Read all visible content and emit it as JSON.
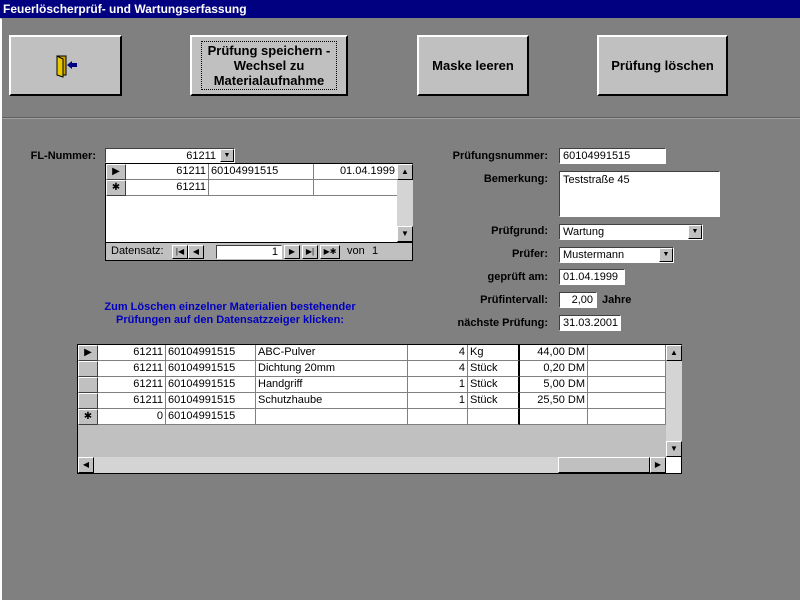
{
  "window": {
    "title": "Feuerlöscherprüf- und Wartungserfassung"
  },
  "toolbar": {
    "save_label": "Prüfung speichern - Wechsel zu Materialaufnahme",
    "clear_label": "Maske leeren",
    "delete_label": "Prüfung löschen"
  },
  "form": {
    "fl_nummer_label": "FL-Nummer:",
    "fl_nummer_value": "61211",
    "pruefungsnummer_label": "Prüfungsnummer:",
    "pruefungsnummer_value": "60104991515",
    "bemerkung_label": "Bemerkung:",
    "bemerkung_value": "Teststraße 45",
    "pruefgrund_label": "Prüfgrund:",
    "pruefgrund_value": "Wartung",
    "pruefer_label": "Prüfer:",
    "pruefer_value": "Mustermann",
    "geprueft_am_label": "geprüft am:",
    "geprueft_am_value": "01.04.1999",
    "pruefintervall_label": "Prüfintervall:",
    "pruefintervall_value": "2,00",
    "pruefintervall_unit": "Jahre",
    "naechste_pruefung_label": "nächste Prüfung:",
    "naechste_pruefung_value": "31.03.2001"
  },
  "subform": {
    "rows": [
      {
        "fl": "61211",
        "nummer": "60104991515",
        "datum": "01.04.1999"
      },
      {
        "fl": "61211",
        "nummer": "",
        "datum": ""
      }
    ],
    "nav": {
      "label": "Datensatz:",
      "current": "1",
      "of_label": "von",
      "total": "1"
    }
  },
  "info_text": "Zum Löschen einzelner Materialien bestehender Prüfungen auf den Datensatzzeiger klicken:",
  "materials": {
    "rows": [
      {
        "fl": "61211",
        "nummer": "60104991515",
        "material": "ABC-Pulver",
        "menge": "4",
        "einheit": "Kg",
        "preis": "44,00 DM"
      },
      {
        "fl": "61211",
        "nummer": "60104991515",
        "material": "Dichtung 20mm",
        "menge": "4",
        "einheit": "Stück",
        "preis": "0,20 DM"
      },
      {
        "fl": "61211",
        "nummer": "60104991515",
        "material": "Handgriff",
        "menge": "1",
        "einheit": "Stück",
        "preis": "5,00 DM"
      },
      {
        "fl": "61211",
        "nummer": "60104991515",
        "material": "Schutzhaube",
        "menge": "1",
        "einheit": "Stück",
        "preis": "25,50 DM"
      },
      {
        "fl": "0",
        "nummer": "60104991515",
        "material": "",
        "menge": "",
        "einheit": "",
        "preis": ""
      }
    ]
  }
}
